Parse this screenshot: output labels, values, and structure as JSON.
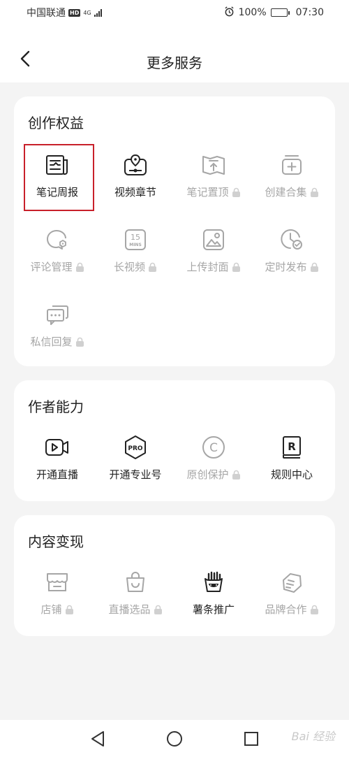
{
  "status_bar": {
    "carrier": "中国联通",
    "hd_badge": "HD",
    "network": "4G",
    "battery_percent": "100%",
    "time": "07:30"
  },
  "header": {
    "title": "更多服务"
  },
  "sections": {
    "creation": {
      "title": "创作权益",
      "items": [
        {
          "label": "笔记周报",
          "icon": "weekly-report-icon",
          "locked": false
        },
        {
          "label": "视频章节",
          "icon": "video-chapter-icon",
          "locked": false
        },
        {
          "label": "笔记置顶",
          "icon": "pin-top-icon",
          "locked": true
        },
        {
          "label": "创建合集",
          "icon": "create-collection-icon",
          "locked": true
        },
        {
          "label": "评论管理",
          "icon": "comment-manage-icon",
          "locked": true
        },
        {
          "label": "长视频",
          "icon": "long-video-icon",
          "icon_text_top": "15",
          "icon_text_bottom": "MINS",
          "locked": true
        },
        {
          "label": "上传封面",
          "icon": "upload-cover-icon",
          "locked": true
        },
        {
          "label": "定时发布",
          "icon": "scheduled-publish-icon",
          "locked": true
        },
        {
          "label": "私信回复",
          "icon": "message-reply-icon",
          "locked": true
        }
      ]
    },
    "author": {
      "title": "作者能力",
      "items": [
        {
          "label": "开通直播",
          "icon": "live-stream-icon",
          "locked": false
        },
        {
          "label": "开通专业号",
          "icon": "pro-account-icon",
          "icon_text": "PRO",
          "locked": false
        },
        {
          "label": "原创保护",
          "icon": "copyright-icon",
          "icon_text": "C",
          "locked": true
        },
        {
          "label": "规则中心",
          "icon": "rules-center-icon",
          "icon_text": "R",
          "locked": false
        }
      ]
    },
    "monetize": {
      "title": "内容变现",
      "items": [
        {
          "label": "店铺",
          "icon": "shop-icon",
          "locked": true
        },
        {
          "label": "直播选品",
          "icon": "live-selection-icon",
          "locked": true
        },
        {
          "label": "薯条推广",
          "icon": "fries-promotion-icon",
          "locked": false
        },
        {
          "label": "品牌合作",
          "icon": "brand-cooperation-icon",
          "locked": true
        }
      ]
    }
  },
  "watermark": "Bai 经验",
  "colors": {
    "highlight": "#c8202a",
    "active_text": "#222222",
    "disabled_text": "#a6a6a6",
    "background": "#f4f4f4",
    "card": "#ffffff"
  }
}
